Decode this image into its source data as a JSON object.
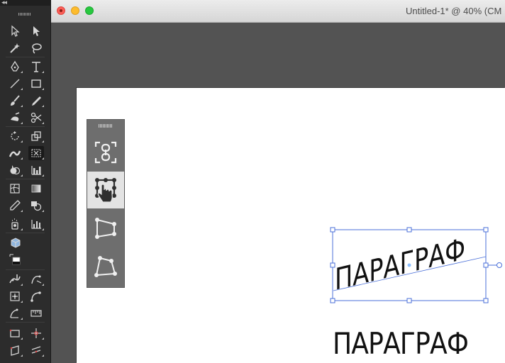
{
  "document": {
    "title": "Untitled-1* @ 40% (CM"
  },
  "tools_panel": {
    "tools": [
      "selection-tool",
      "direct-selection-tool",
      "magic-wand-tool",
      "lasso-tool",
      "pen-tool",
      "type-tool",
      "line-segment-tool",
      "rectangle-tool",
      "paintbrush-tool",
      "pencil-tool",
      "shaper-tool",
      "scissors-tool",
      "rotate-tool",
      "scale-tool",
      "width-tool",
      "free-transform-tool",
      "shape-builder-tool",
      "chart-tool",
      "mesh-tool",
      "gradient-tool",
      "eyedropper-tool",
      "blend-tool",
      "symbol-sprayer-tool",
      "column-graph-tool",
      "artboard-tool",
      "fill-stroke-swatch",
      "puppet-warp-tool",
      "curvature-tool",
      "crop-tool",
      "measure-tool",
      "perspective-grid-tool",
      "ruler-tool",
      "shape-tool-a",
      "shape-tool-b",
      "shape-tool-c",
      "shape-tool-d"
    ],
    "selected_tool": "free-transform-tool"
  },
  "free_transform_widget": {
    "buttons": [
      "constrain",
      "free-transform",
      "perspective-distort",
      "free-distort"
    ],
    "active_button": "free-transform"
  },
  "text_objects": {
    "transformed": "ПАРАГРАФ",
    "plain": "ПАРАГРАФ"
  },
  "colors": {
    "selection": "#4a6fd8",
    "canvas": "#535353",
    "artboard": "#ffffff",
    "panel": "#2c2c2c"
  }
}
